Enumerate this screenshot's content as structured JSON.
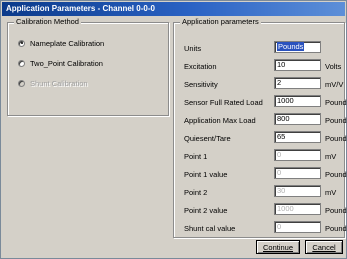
{
  "window": {
    "title": "Application Parameters - Channel 0-0-0"
  },
  "calibration": {
    "title": "Calibration Method",
    "options": [
      {
        "label": "Nameplate Calibration",
        "checked": true,
        "enabled": true
      },
      {
        "label": "Two_Point Calibration",
        "checked": false,
        "enabled": true
      },
      {
        "label": "Shunt Calibration",
        "checked": false,
        "enabled": false
      }
    ]
  },
  "params": {
    "title": "Application parameters",
    "rows": [
      {
        "label": "Units",
        "value": "Pounds",
        "unit": "",
        "enabled": true,
        "selected": true
      },
      {
        "label": "Excitation",
        "value": "10",
        "unit": "Volts",
        "enabled": true
      },
      {
        "label": "Sensitivity",
        "value": "2",
        "unit": "mV/V",
        "enabled": true
      },
      {
        "label": "Sensor Full Rated Load",
        "value": "1000",
        "unit": "Pounds",
        "enabled": true
      },
      {
        "label": "Application Max Load",
        "value": "800",
        "unit": "Pounds",
        "enabled": true
      },
      {
        "label": "Quiesent/Tare",
        "value": "65",
        "unit": "Pounds",
        "enabled": true
      },
      {
        "label": "Point 1",
        "value": "0",
        "unit": "mV",
        "enabled": false
      },
      {
        "label": "Point 1 value",
        "value": "0",
        "unit": "Pounds",
        "enabled": false
      },
      {
        "label": "Point 2",
        "value": "30",
        "unit": "mV",
        "enabled": false
      },
      {
        "label": "Point 2 value",
        "value": "1000",
        "unit": "Pounds",
        "enabled": false
      },
      {
        "label": "Shunt cal value",
        "value": "0",
        "unit": "Pounds",
        "enabled": false
      }
    ]
  },
  "buttons": {
    "continue": "Continue",
    "cancel": "Cancel"
  }
}
